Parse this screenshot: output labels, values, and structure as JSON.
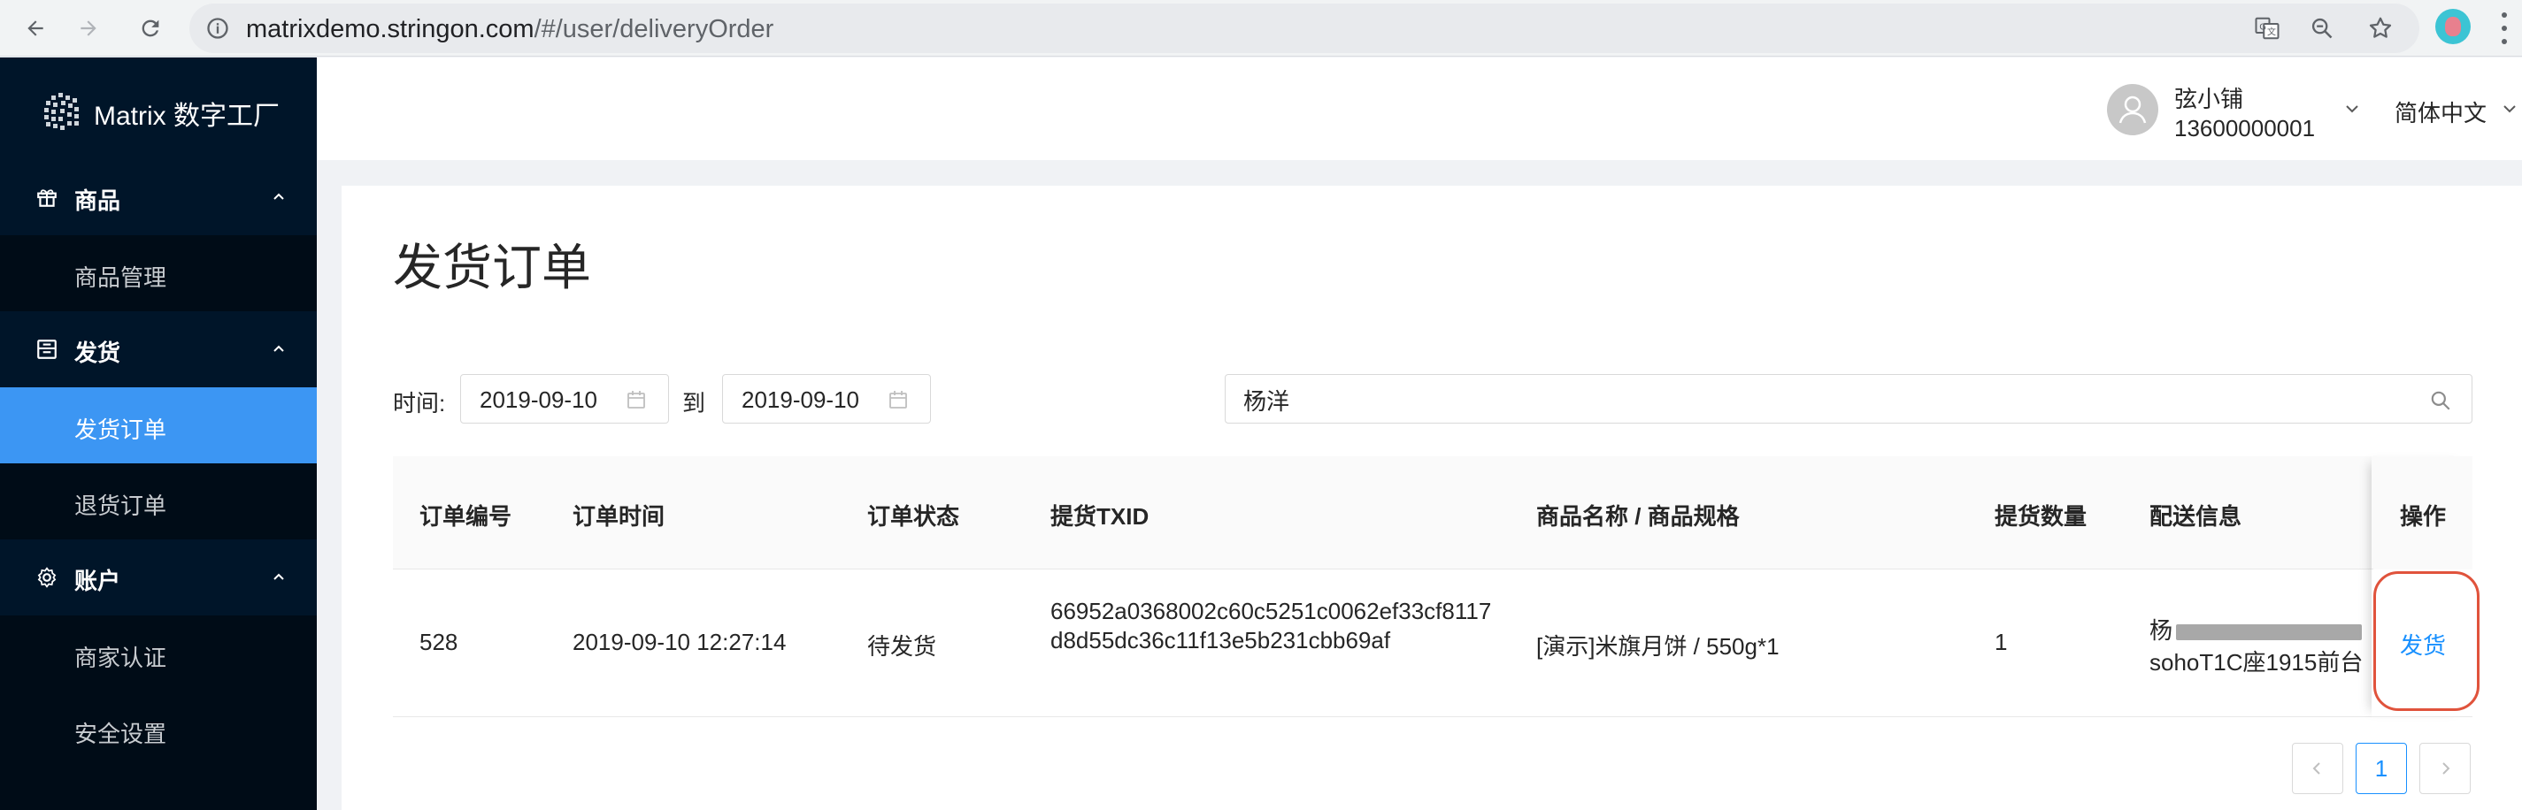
{
  "browser": {
    "url_host": "matrixdemo.stringon.com",
    "url_path": "/#/user/deliveryOrder"
  },
  "sidebar": {
    "logo_text": "Matrix 数字工厂",
    "groups": [
      {
        "label": "商品",
        "icon": "gift-icon",
        "items": [
          {
            "label": "商品管理",
            "active": false
          }
        ]
      },
      {
        "label": "发货",
        "icon": "box-icon",
        "items": [
          {
            "label": "发货订单",
            "active": true
          },
          {
            "label": "退货订单",
            "active": false
          }
        ]
      },
      {
        "label": "账户",
        "icon": "gear-icon",
        "items": [
          {
            "label": "商家认证",
            "active": false
          },
          {
            "label": "安全设置",
            "active": false
          }
        ]
      }
    ]
  },
  "header": {
    "user_name": "弦小铺",
    "user_phone": "13600000001",
    "language": "简体中文"
  },
  "page": {
    "title": "发货订单",
    "filter": {
      "time_label": "时间:",
      "start_date": "2019-09-10",
      "to_label": "到",
      "end_date": "2019-09-10",
      "search_value": "杨洋"
    },
    "table": {
      "columns": [
        "订单编号",
        "订单时间",
        "订单状态",
        "提货TXID",
        "商品名称 / 商品规格",
        "提货数量",
        "配送信息",
        "操作"
      ],
      "rows": [
        {
          "order_no": "528",
          "order_time": "2019-09-10 12:27:14",
          "status": "待发货",
          "txid": "66952a0368002c60c5251c0062ef33cf8117d8d55dc36c11f13e5b231cbb69af",
          "product": "[演示]米旗月饼 / 550g*1",
          "quantity": "1",
          "delivery_line1": "杨",
          "delivery_line2": "sohoT1C座1915前台",
          "action": "发货"
        }
      ]
    },
    "pagination": {
      "current": "1"
    }
  },
  "colors": {
    "sidebar_bg": "#001529",
    "menu_active": "#3c96f3",
    "link": "#1890ff",
    "highlight_ring": "#e0533c"
  }
}
